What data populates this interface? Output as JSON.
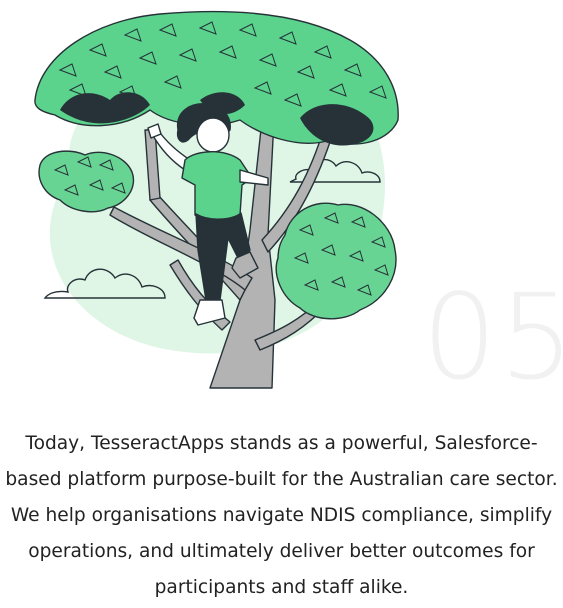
{
  "illustration": {
    "icon": "girl-climbing-tree-illustration",
    "colors": {
      "accent_green": "#5bd38d",
      "blob_green": "#dff6e6",
      "leaf_green": "#68d493",
      "outline": "#263238",
      "trunk_gray": "#b3b3b3"
    }
  },
  "step": {
    "number": "05",
    "color": "#f1f1f1"
  },
  "story": {
    "text": "Today, TesseractApps stands as a powerful, Salesforce-based platform purpose-built for the Australian care sector. We help organisations navigate NDIS compliance, simplify operations, and ultimately deliver better outcomes for participants and staff alike."
  }
}
